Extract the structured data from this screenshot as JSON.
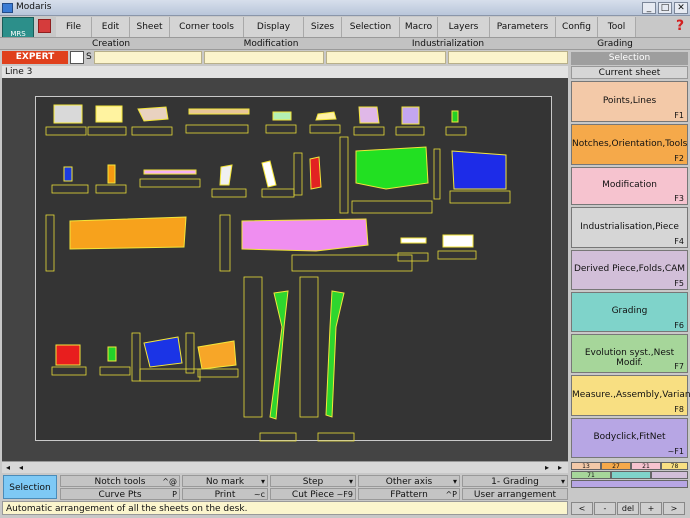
{
  "window": {
    "title": "Modaris",
    "min": "_",
    "max": "□",
    "close": "✕"
  },
  "logo": {
    "text": "MRS"
  },
  "menu": [
    "File",
    "Edit",
    "Sheet",
    "Corner tools",
    "Display",
    "Sizes",
    "Selection",
    "Macro",
    "Layers",
    "Parameters",
    "Config",
    "Tool"
  ],
  "help": "?",
  "categories": [
    "Creation",
    "Modification",
    "Industrialization",
    "Grading"
  ],
  "mode": {
    "label": "EXPERT",
    "s_label": "S"
  },
  "side": {
    "selection": "Selection",
    "current_sheet": "Current sheet",
    "panels": [
      {
        "label": "Points,Lines",
        "key": "F1",
        "color": "#f3c9a8"
      },
      {
        "label": "Notches,Orientation,Tools",
        "key": "F2",
        "color": "#f5a94a"
      },
      {
        "label": "Modification",
        "key": "F3",
        "color": "#f6c3cf"
      },
      {
        "label": "Industrialisation,Piece",
        "key": "F4",
        "color": "#d6d6d6"
      },
      {
        "label": "Derived Piece,Folds,CAM",
        "key": "F5",
        "color": "#d2bfd9"
      },
      {
        "label": "Grading",
        "key": "F6",
        "color": "#7fd3ca"
      },
      {
        "label": "Evolution syst.,Nest Modif.",
        "key": "F7",
        "color": "#a6d69a"
      },
      {
        "label": "Measure.,Assembly,Variant",
        "key": "F8",
        "color": "#f8df82"
      },
      {
        "label": "Bodyclick,FitNet",
        "key": "~F1",
        "color": "#b7a6e4"
      }
    ]
  },
  "canvas": {
    "line_label": "Line 3"
  },
  "pieces": [
    {
      "color": "#d9d9d9"
    },
    {
      "color": "#fff3a0"
    },
    {
      "color": "#e9d2c0"
    },
    {
      "color": "#e8c59a"
    },
    {
      "color": "#b4f0b4"
    },
    {
      "color": "#fff1a8"
    },
    {
      "color": "#e0b8e8"
    },
    {
      "color": "#c3a6f0"
    },
    {
      "color": "#25d225"
    },
    {
      "color": "#1b3be0"
    },
    {
      "color": "#f59a12"
    },
    {
      "color": "#f4b2f4"
    },
    {
      "color": "#f0f0f0"
    },
    {
      "color": "#ffffff"
    },
    {
      "color": "#e22222"
    },
    {
      "color": "#22e022"
    },
    {
      "color": "#1d2ce8"
    },
    {
      "color": "#f7a21c"
    },
    {
      "color": "#ef8ef0"
    },
    {
      "color": "#ffffff"
    },
    {
      "color": "#ffffff"
    },
    {
      "color": "#e81e1e"
    },
    {
      "color": "#22d22a"
    },
    {
      "color": "#1b34e6"
    },
    {
      "color": "#f7a628"
    },
    {
      "color": "#2ed62e"
    },
    {
      "color": "#2ed62e"
    }
  ],
  "options": {
    "select": "Selection",
    "row1": [
      {
        "label": "Notch tools",
        "key": "^@"
      },
      {
        "label": "No mark",
        "key": "▾"
      },
      {
        "label": "Step",
        "key": "▾"
      },
      {
        "label": "Other axis",
        "key": "▾"
      },
      {
        "label": "1- Grading",
        "key": "▾"
      }
    ],
    "row2": [
      {
        "label": "Curve Pts",
        "key": "P"
      },
      {
        "label": "Print",
        "key": "~c"
      },
      {
        "label": "Cut Piece",
        "key": "~F9"
      },
      {
        "label": "FPattern",
        "key": "^P"
      },
      {
        "label": "User arrangement",
        "key": ""
      }
    ]
  },
  "status": "Automatic arrangement of all the sheets on the desk.",
  "mini": {
    "values": [
      "13",
      "27",
      "21",
      "78",
      "71"
    ],
    "nav": [
      "<",
      "-",
      "del",
      "+",
      ">"
    ]
  }
}
